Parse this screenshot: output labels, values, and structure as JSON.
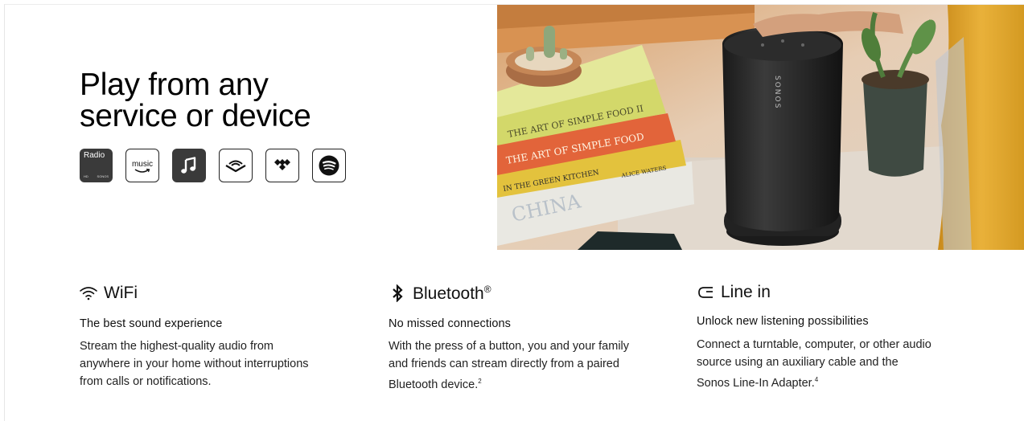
{
  "headline": {
    "line1": "Play from any",
    "line2": "service or device"
  },
  "services": {
    "radio": {
      "label": "Radio",
      "hd": "HD",
      "brand": "SONOS"
    },
    "amazon": {
      "label": "music"
    },
    "icons": [
      "sonos-radio-icon",
      "amazon-music-icon",
      "apple-music-icon",
      "audible-icon",
      "tidal-icon",
      "spotify-icon"
    ]
  },
  "photo": {
    "book1": "THE ART OF SIMPLE FOOD II",
    "book2": "THE ART OF SIMPLE FOOD",
    "book3": "IN THE GREEN KITCHEN",
    "book3_author": "ALICE WATERS",
    "book4": "CHINA",
    "speaker_brand": "SONOS"
  },
  "features": [
    {
      "icon": "wifi-icon",
      "title": "WiFi",
      "subtitle": "The best sound experience",
      "body_lines": [
        "Stream the highest-quality audio from",
        "anywhere in your home without interruptions",
        "from calls or notifications."
      ],
      "footnote": ""
    },
    {
      "icon": "bluetooth-icon",
      "title": "Bluetooth",
      "title_mark": "®",
      "subtitle": "No missed connections",
      "body_lines": [
        "With the press of a button, you and your family",
        "and friends can stream directly from a paired",
        "Bluetooth device."
      ],
      "footnote": "2"
    },
    {
      "icon": "line-in-icon",
      "title": "Line in",
      "subtitle": "Unlock new listening possibilities",
      "body_lines": [
        "Connect a turntable, computer, or other audio",
        "source using an auxiliary cable and the",
        "Sonos Line-In Adapter."
      ],
      "footnote": "4"
    }
  ],
  "colors": {
    "text": "#000000",
    "icon_dark": "#3a3a3a",
    "background": "#ffffff"
  }
}
